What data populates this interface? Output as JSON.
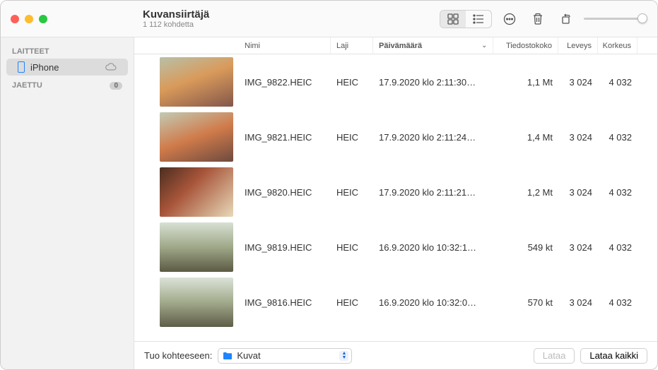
{
  "header": {
    "title": "Kuvansiirtäjä",
    "subtitle": "1 112 kohdetta"
  },
  "sidebar": {
    "devices_label": "LAITTEET",
    "shared_label": "JAETTU",
    "shared_count": "0",
    "device_name": "iPhone"
  },
  "columns": {
    "name": "Nimi",
    "type": "Laji",
    "date": "Päivämäärä",
    "size": "Tiedostokoko",
    "width": "Leveys",
    "height": "Korkeus"
  },
  "rows": [
    {
      "name": "IMG_9822.HEIC",
      "type": "HEIC",
      "date": "17.9.2020 klo 2:11:30…",
      "size": "1,1 Mt",
      "w": "3 024",
      "h": "4 032",
      "grad": "linear-gradient(160deg,#b8c0a8 0%,#d99a5a 45%,#83564b 100%)"
    },
    {
      "name": "IMG_9821.HEIC",
      "type": "HEIC",
      "date": "17.9.2020 klo 2:11:24…",
      "size": "1,4 Mt",
      "w": "3 024",
      "h": "4 032",
      "grad": "linear-gradient(160deg,#c2cab4 0%,#d07b4a 50%,#6d4a3f 100%)"
    },
    {
      "name": "IMG_9820.HEIC",
      "type": "HEIC",
      "date": "17.9.2020 klo 2:11:21…",
      "size": "1,2 Mt",
      "w": "3 024",
      "h": "4 032",
      "grad": "linear-gradient(135deg,#4a2e20 0%,#a8553a 40%,#e8d9b8 100%)"
    },
    {
      "name": "IMG_9819.HEIC",
      "type": "HEIC",
      "date": "16.9.2020 klo 10:32:1…",
      "size": "549 kt",
      "w": "3 024",
      "h": "4 032",
      "grad": "linear-gradient(180deg,#d8e0d4 0%,#9fa888 50%,#5b5a44 100%)"
    },
    {
      "name": "IMG_9816.HEIC",
      "type": "HEIC",
      "date": "16.9.2020 klo 10:32:0…",
      "size": "570 kt",
      "w": "3 024",
      "h": "4 032",
      "grad": "linear-gradient(180deg,#dce3d8 0%,#a2aa8c 50%,#5f5d47 100%)"
    }
  ],
  "footer": {
    "import_to": "Tuo kohteeseen:",
    "dest": "Kuvat",
    "download": "Lataa",
    "download_all": "Lataa kaikki"
  }
}
